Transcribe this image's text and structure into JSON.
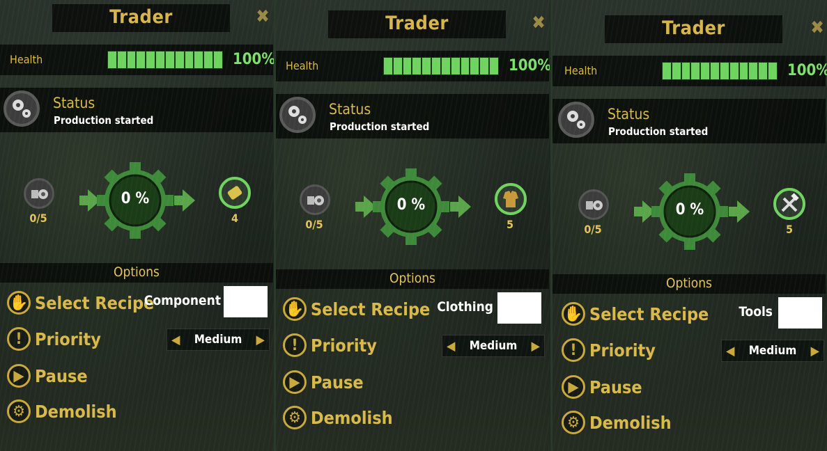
{
  "panels": [
    {
      "title": "Trader",
      "close_icon": "close-icon",
      "health_label": "Health",
      "health_pct": "100%",
      "health_value": 1.0,
      "status_title": "Status",
      "status_text": "Production started",
      "input_count": "0/5",
      "progress": "0 %",
      "output_count": "4",
      "output_icon": "component-icon",
      "options_title": "Options",
      "select_recipe": "Select Recipe",
      "recipe_name": "Component",
      "priority": "Priority",
      "priority_value": "Medium",
      "pause": "Pause",
      "demolish": "Demolish"
    },
    {
      "title": "Trader",
      "close_icon": "close-icon",
      "health_label": "Health",
      "health_pct": "100%",
      "health_value": 1.0,
      "status_title": "Status",
      "status_text": "Production started",
      "input_count": "0/5",
      "progress": "0 %",
      "output_count": "5",
      "output_icon": "clothing-icon",
      "options_title": "Options",
      "select_recipe": "Select Recipe",
      "recipe_name": "Clothing",
      "priority": "Priority",
      "priority_value": "Medium",
      "pause": "Pause",
      "demolish": "Demolish"
    },
    {
      "title": "Trader",
      "close_icon": "close-icon",
      "health_label": "Health",
      "health_pct": "100%",
      "health_value": 1.0,
      "status_title": "Status",
      "status_text": "Production started",
      "input_count": "0/5",
      "progress": "0 %",
      "output_count": "5",
      "output_icon": "tools-icon",
      "options_title": "Options",
      "select_recipe": "Select Recipe",
      "recipe_name": "Tools",
      "priority": "Priority",
      "priority_value": "Medium",
      "pause": "Pause",
      "demolish": "Demolish"
    }
  ]
}
